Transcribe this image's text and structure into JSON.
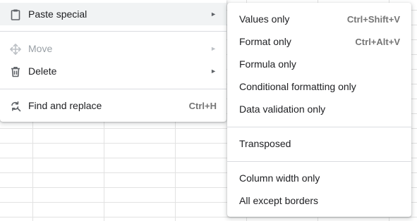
{
  "main_menu": {
    "items": [
      {
        "label": "Paste special",
        "icon": "clipboard-icon",
        "submenu": true,
        "state": "highlighted"
      },
      {
        "label": "Move",
        "icon": "move-arrows-icon",
        "submenu": true,
        "state": "disabled"
      },
      {
        "label": "Delete",
        "icon": "trash-icon",
        "submenu": true,
        "state": "enabled"
      },
      {
        "label": "Find and replace",
        "icon": "find-replace-icon",
        "shortcut": "Ctrl+H",
        "state": "enabled"
      }
    ],
    "submenu_arrow": "►"
  },
  "paste_special_menu": {
    "items": [
      {
        "label": "Values only",
        "shortcut": "Ctrl+Shift+V"
      },
      {
        "label": "Format only",
        "shortcut": "Ctrl+Alt+V"
      },
      {
        "label": "Formula only"
      },
      {
        "label": "Conditional formatting only"
      },
      {
        "label": "Data validation only"
      },
      {
        "label": "Transposed"
      },
      {
        "label": "Column width only"
      },
      {
        "label": "All except borders"
      }
    ]
  },
  "colors": {
    "highlight": "#f1f3f4",
    "separator": "#dadce0",
    "text": "#202124",
    "disabled_text": "#9aa0a6",
    "shortcut_text": "#757575",
    "grid_line": "#e2e2e2"
  }
}
